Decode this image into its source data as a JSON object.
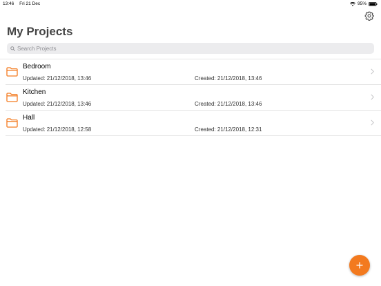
{
  "status_bar": {
    "time": "13:46",
    "date": "Fri 21 Dec",
    "battery": "95%"
  },
  "header": {
    "title": "My Projects",
    "settings_icon": "gear-icon"
  },
  "search": {
    "placeholder": "Search Projects",
    "value": ""
  },
  "projects": [
    {
      "name": "Bedroom",
      "updated": "Updated: 21/12/2018, 13:46",
      "created": "Created: 21/12/2018, 13:46"
    },
    {
      "name": "Kitchen",
      "updated": "Updated: 21/12/2018, 13:46",
      "created": "Created: 21/12/2018, 13:46"
    },
    {
      "name": "Hall",
      "updated": "Updated: 21/12/2018, 12:58",
      "created": "Created: 21/12/2018, 12:31"
    }
  ],
  "colors": {
    "accent": "#f37a1f",
    "folder": "#f37a1f"
  },
  "fab": {
    "icon": "plus-icon"
  }
}
